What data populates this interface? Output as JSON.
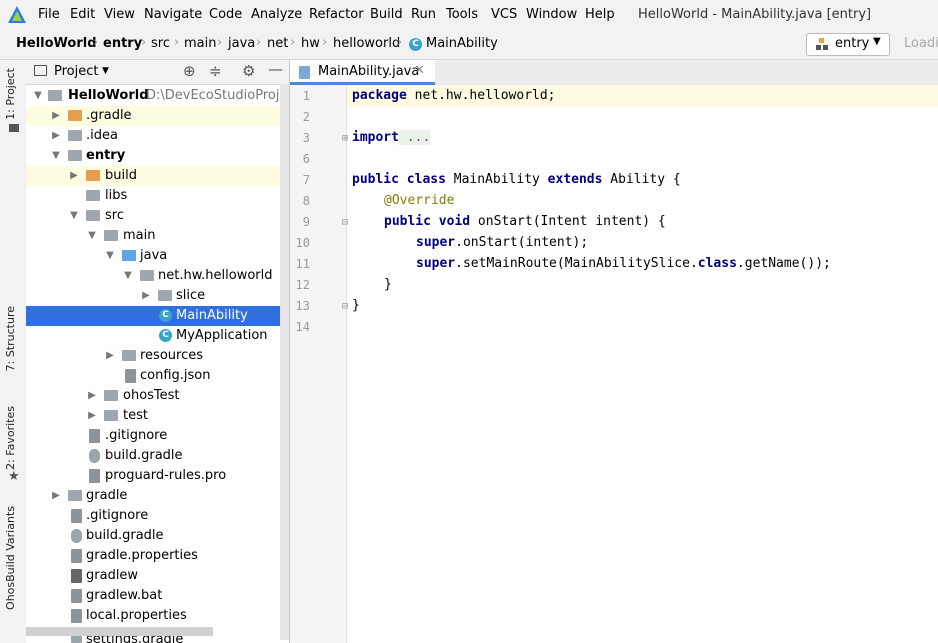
{
  "menu": {
    "items": [
      "File",
      "Edit",
      "View",
      "Navigate",
      "Code",
      "Analyze",
      "Refactor",
      "Build",
      "Run",
      "Tools",
      "VCS",
      "Window",
      "Help"
    ],
    "window_title": "HelloWorld - MainAbility.java [entry]"
  },
  "breadcrumb": {
    "items": [
      "HelloWorld",
      "entry",
      "src",
      "main",
      "java",
      "net",
      "hw",
      "helloworld",
      "MainAbility"
    ],
    "run_config": "entry",
    "load_label": "Loadi"
  },
  "left_strip": {
    "project_tab": "1: Project",
    "structure_tab": "7: Structure",
    "favorites_tab": "2: Favorites",
    "variants_tab": "OhosBuild Variants"
  },
  "project_panel": {
    "title": "Project",
    "tree": [
      {
        "label": "HelloWorld",
        "path": "D:\\DevEcoStudioProjects",
        "bold": true
      },
      {
        "label": ".gradle"
      },
      {
        "label": ".idea"
      },
      {
        "label": "entry",
        "bold": true
      },
      {
        "label": "build"
      },
      {
        "label": "libs"
      },
      {
        "label": "src"
      },
      {
        "label": "main"
      },
      {
        "label": "java"
      },
      {
        "label": "net.hw.helloworld"
      },
      {
        "label": "slice"
      },
      {
        "label": "MainAbility"
      },
      {
        "label": "MyApplication"
      },
      {
        "label": "resources"
      },
      {
        "label": "config.json"
      },
      {
        "label": "ohosTest"
      },
      {
        "label": "test"
      },
      {
        "label": ".gitignore"
      },
      {
        "label": "build.gradle"
      },
      {
        "label": "proguard-rules.pro"
      },
      {
        "label": "gradle"
      },
      {
        "label": ".gitignore"
      },
      {
        "label": "build.gradle"
      },
      {
        "label": "gradle.properties"
      },
      {
        "label": "gradlew"
      },
      {
        "label": "gradlew.bat"
      },
      {
        "label": "local.properties"
      },
      {
        "label": "settings.gradle"
      }
    ]
  },
  "editor": {
    "tab_label": "MainAbility.java",
    "line_numbers": [
      "1",
      "2",
      "3",
      "6",
      "7",
      "8",
      "9",
      "10",
      "11",
      "12",
      "13",
      "14"
    ],
    "code": {
      "l1_kw": "package",
      "l1_rest": " net.hw.helloworld;",
      "l3_kw": "import",
      "l3_rest": " ...",
      "l7_kw1": "public class",
      "l7_mid": " MainAbility ",
      "l7_kw2": "extends",
      "l7_rest": " Ability {",
      "l8": "@Override",
      "l9_kw": "public void",
      "l9_rest": " onStart(Intent intent) {",
      "l10_kw": "super",
      "l10_rest": ".onStart(intent);",
      "l11_kw": "super",
      "l11_mid": ".setMainRoute(MainAbilitySlice.",
      "l11_kw2": "class",
      "l11_rest": ".getName());",
      "l12": "}",
      "l13": "}"
    }
  }
}
